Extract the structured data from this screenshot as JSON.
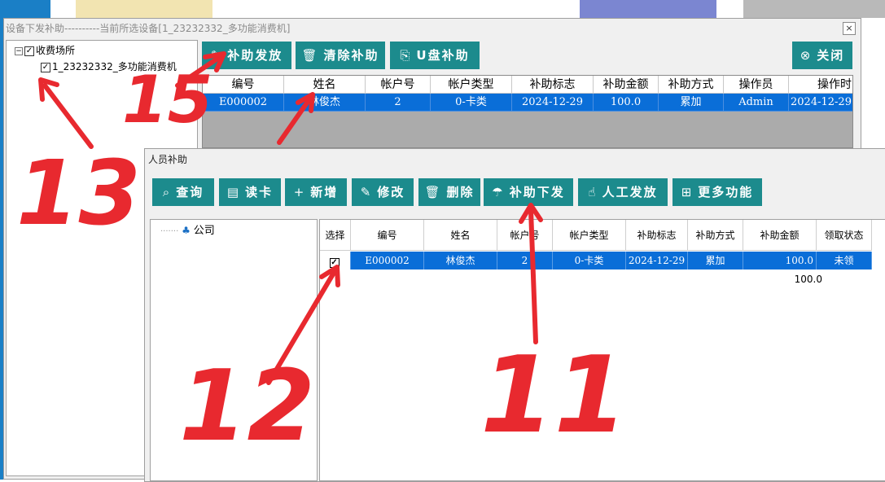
{
  "window1": {
    "title": "设备下发补助----------当前所选设备[1_23232332_多功能消费机]",
    "close_glyph": "×",
    "tree": {
      "root_label": "收费场所",
      "child_label": "1_23232332_多功能消费机"
    },
    "buttons": {
      "issue": "补助发放",
      "clear": "清除补助",
      "usb": "U盘补助",
      "close": "关闭"
    },
    "grid": {
      "columns": [
        "编号",
        "姓名",
        "帐户号",
        "帐户类型",
        "补助标志",
        "补助金额",
        "补助方式",
        "操作员",
        "操作时"
      ],
      "row": [
        "E000002",
        "林俊杰",
        "2",
        "0-卡类",
        "2024-12-29",
        "100.0",
        "累加",
        "Admin",
        "2024-12-29"
      ]
    }
  },
  "window2": {
    "title": "人员补助",
    "buttons": {
      "query": "查询",
      "read_card": "读卡",
      "add": "新增",
      "edit": "修改",
      "delete": "删除",
      "issue_subsidy": "补助下发",
      "manual_issue": "人工发放",
      "more": "更多功能"
    },
    "tree": {
      "root_label": "公司"
    },
    "grid": {
      "columns": [
        "选择",
        "编号",
        "姓名",
        "帐户号",
        "帐户类型",
        "补助标志",
        "补助方式",
        "补助金额",
        "领取状态"
      ],
      "row": [
        "",
        "E000002",
        "林俊杰",
        "2",
        "0-卡类",
        "2024-12-29",
        "累加",
        "100.0",
        "未领"
      ],
      "total": "100.0"
    }
  },
  "annotations": [
    "13",
    "15",
    "12",
    "11"
  ],
  "colors": {
    "button_teal": "#1c8b8d",
    "selection_blue": "#0a6ed8",
    "annotation_red": "#e8292f"
  }
}
